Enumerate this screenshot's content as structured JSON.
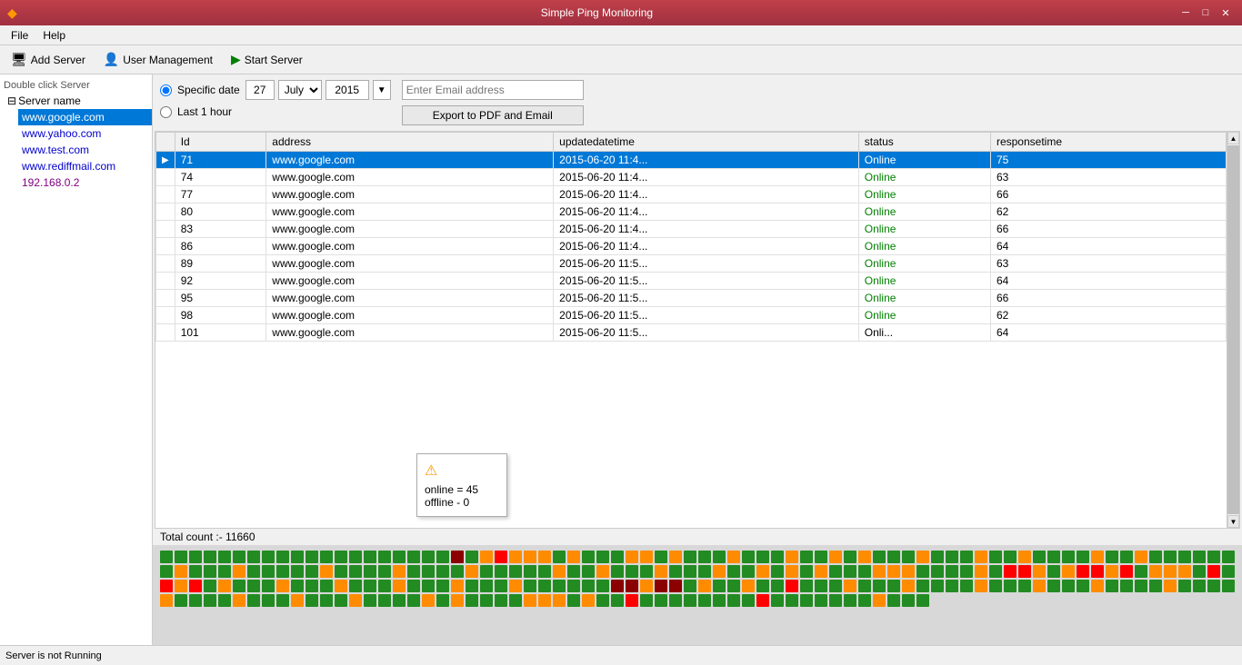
{
  "titleBar": {
    "title": "Simple Ping Monitoring",
    "icon": "◆"
  },
  "winControls": {
    "minimize": "─",
    "maximize": "□",
    "close": "✕"
  },
  "menuBar": {
    "items": [
      "File",
      "Help"
    ]
  },
  "toolbar": {
    "addServer": "Add Server",
    "userManagement": "User Management",
    "startServer": "Start Server"
  },
  "sidebar": {
    "hint": "Double click Server",
    "rootLabel": "Server name",
    "items": [
      {
        "label": "www.google.com",
        "selected": true,
        "color": "blue"
      },
      {
        "label": "www.yahoo.com",
        "color": "blue"
      },
      {
        "label": "www.test.com",
        "color": "blue"
      },
      {
        "label": "www.rediffmail.com",
        "color": "blue"
      },
      {
        "label": "192.168.0.2",
        "color": "purple"
      }
    ]
  },
  "controls": {
    "specificDate": "Specific date",
    "lastHour": "Last 1 hour",
    "day": "27",
    "month": "July",
    "year": "2015",
    "emailPlaceholder": "Enter Email address",
    "exportBtn": "Export to PDF and Email"
  },
  "table": {
    "columns": [
      "",
      "Id",
      "address",
      "updatedatetime",
      "status",
      "responsetime"
    ],
    "rows": [
      {
        "id": "71",
        "address": "www.google.com",
        "updatetime": "2015-06-20 11:4...",
        "status": "Online",
        "responsetime": "75",
        "selected": true,
        "arrow": "▶"
      },
      {
        "id": "74",
        "address": "www.google.com",
        "updatetime": "2015-06-20 11:4...",
        "status": "Online",
        "responsetime": "63"
      },
      {
        "id": "77",
        "address": "www.google.com",
        "updatetime": "2015-06-20 11:4...",
        "status": "Online",
        "responsetime": "66"
      },
      {
        "id": "80",
        "address": "www.google.com",
        "updatetime": "2015-06-20 11:4...",
        "status": "Online",
        "responsetime": "62"
      },
      {
        "id": "83",
        "address": "www.google.com",
        "updatetime": "2015-06-20 11:4...",
        "status": "Online",
        "responsetime": "66"
      },
      {
        "id": "86",
        "address": "www.google.com",
        "updatetime": "2015-06-20 11:4...",
        "status": "Online",
        "responsetime": "64"
      },
      {
        "id": "89",
        "address": "www.google.com",
        "updatetime": "2015-06-20 11:5...",
        "status": "Online",
        "responsetime": "63"
      },
      {
        "id": "92",
        "address": "www.google.com",
        "updatetime": "2015-06-20 11:5...",
        "status": "Online",
        "responsetime": "64"
      },
      {
        "id": "95",
        "address": "www.google.com",
        "updatetime": "2015-06-20 11:5...",
        "status": "Online",
        "responsetime": "66"
      },
      {
        "id": "98",
        "address": "www.google.com",
        "updatetime": "2015-06-20 11:5...",
        "status": "Online",
        "responsetime": "62"
      },
      {
        "id": "101",
        "address": "www.google.com",
        "updatetime": "2015-06-20 11:5...",
        "status": "Onli...",
        "responsetime": "64"
      }
    ]
  },
  "tooltip": {
    "warningIcon": "⚠",
    "line1": "online = 45",
    "line2": "offline - 0"
  },
  "totalCount": "Total count :- 11660",
  "heatmap": {
    "colors": [
      "#228B22",
      "#228B22",
      "#228B22",
      "#228B22",
      "#228B22",
      "#228B22",
      "#228B22",
      "#228B22",
      "#228B22",
      "#228B22",
      "#228B22",
      "#228B22",
      "#228B22",
      "#228B22",
      "#228B22",
      "#228B22",
      "#228B22",
      "#228B22",
      "#228B22",
      "#228B22",
      "#8B0000",
      "#228B22",
      "#FF8C00",
      "#FF0000",
      "#FF8C00",
      "#FF8C00",
      "#FF8C00",
      "#228B22",
      "#FF8C00",
      "#228B22",
      "#228B22",
      "#228B22",
      "#FF8C00",
      "#FF8C00",
      "#228B22",
      "#FF8C00",
      "#228B22",
      "#228B22",
      "#228B22",
      "#FF8C00",
      "#228B22",
      "#228B22",
      "#228B22",
      "#FF8C00",
      "#228B22",
      "#228B22",
      "#FF8C00",
      "#228B22",
      "#FF8C00",
      "#228B22",
      "#228B22",
      "#228B22",
      "#FF8C00",
      "#228B22",
      "#228B22",
      "#228B22",
      "#FF8C00",
      "#228B22",
      "#228B22",
      "#FF8C00",
      "#228B22",
      "#228B22",
      "#228B22",
      "#228B22",
      "#FF8C00",
      "#228B22",
      "#228B22",
      "#FF8C00",
      "#228B22",
      "#228B22",
      "#228B22",
      "#228B22",
      "#228B22",
      "#228B22",
      "#228B22",
      "#FF8C00",
      "#228B22",
      "#228B22",
      "#228B22",
      "#FF8C00",
      "#228B22",
      "#228B22",
      "#228B22",
      "#228B22",
      "#228B22",
      "#FF8C00",
      "#228B22",
      "#228B22",
      "#228B22",
      "#228B22",
      "#FF8C00",
      "#228B22",
      "#228B22",
      "#228B22",
      "#228B22",
      "#FF8C00",
      "#228B22",
      "#228B22",
      "#228B22",
      "#228B22",
      "#228B22",
      "#FF8C00",
      "#228B22",
      "#228B22",
      "#FF8C00",
      "#228B22",
      "#228B22",
      "#228B22",
      "#FF8C00",
      "#228B22",
      "#228B22",
      "#228B22",
      "#FF8C00",
      "#228B22",
      "#228B22",
      "#FF8C00",
      "#228B22",
      "#FF8C00",
      "#228B22",
      "#FF8C00",
      "#228B22",
      "#228B22",
      "#228B22",
      "#FF8C00",
      "#FF8C00",
      "#FF8C00",
      "#228B22",
      "#228B22",
      "#228B22",
      "#228B22",
      "#FF8C00",
      "#228B22",
      "#FF0000",
      "#FF0000",
      "#FF8C00",
      "#228B22",
      "#FF8C00",
      "#FF0000",
      "#FF0000",
      "#FF8C00",
      "#FF0000",
      "#228B22",
      "#FF8C00",
      "#FF8C00",
      "#FF8C00",
      "#228B22",
      "#FF0000",
      "#228B22",
      "#FF0000",
      "#FF8C00",
      "#FF0000",
      "#228B22",
      "#FF8C00",
      "#228B22",
      "#228B22",
      "#228B22",
      "#FF8C00",
      "#228B22",
      "#228B22",
      "#228B22",
      "#FF8C00",
      "#228B22",
      "#228B22",
      "#228B22",
      "#FF8C00",
      "#228B22",
      "#228B22",
      "#228B22",
      "#FF8C00",
      "#228B22",
      "#228B22",
      "#228B22",
      "#FF8C00",
      "#228B22",
      "#228B22",
      "#228B22",
      "#228B22",
      "#228B22",
      "#228B22",
      "#8B0000",
      "#8B0000",
      "#FF8C00",
      "#8B0000",
      "#8B0000",
      "#228B22",
      "#FF8C00",
      "#228B22",
      "#228B22",
      "#FF8C00",
      "#228B22",
      "#228B22",
      "#FF0000",
      "#228B22",
      "#228B22",
      "#228B22",
      "#FF8C00",
      "#228B22",
      "#228B22",
      "#228B22",
      "#FF8C00",
      "#228B22",
      "#228B22",
      "#228B22",
      "#228B22",
      "#FF8C00",
      "#228B22",
      "#228B22",
      "#228B22",
      "#FF8C00",
      "#228B22",
      "#228B22",
      "#228B22",
      "#FF8C00",
      "#228B22",
      "#228B22",
      "#228B22",
      "#228B22",
      "#FF8C00",
      "#228B22",
      "#228B22",
      "#228B22",
      "#228B22",
      "#FF8C00",
      "#228B22",
      "#228B22",
      "#228B22",
      "#228B22",
      "#FF8C00",
      "#228B22",
      "#228B22",
      "#228B22",
      "#FF8C00",
      "#228B22",
      "#228B22",
      "#228B22",
      "#FF8C00",
      "#228B22",
      "#228B22",
      "#228B22",
      "#228B22",
      "#FF8C00",
      "#228B22",
      "#FF8C00",
      "#228B22",
      "#228B22",
      "#228B22",
      "#228B22",
      "#FF8C00",
      "#FF8C00",
      "#FF8C00",
      "#228B22",
      "#FF8C00",
      "#228B22",
      "#228B22",
      "#FF0000",
      "#228B22",
      "#228B22",
      "#228B22",
      "#228B22",
      "#228B22",
      "#228B22",
      "#228B22",
      "#228B22",
      "#FF0000",
      "#228B22",
      "#228B22",
      "#228B22",
      "#228B22",
      "#228B22",
      "#228B22",
      "#228B22",
      "#FF8C00",
      "#228B22",
      "#228B22",
      "#228B22"
    ]
  },
  "statusBar": {
    "text": "Server is not Running"
  }
}
